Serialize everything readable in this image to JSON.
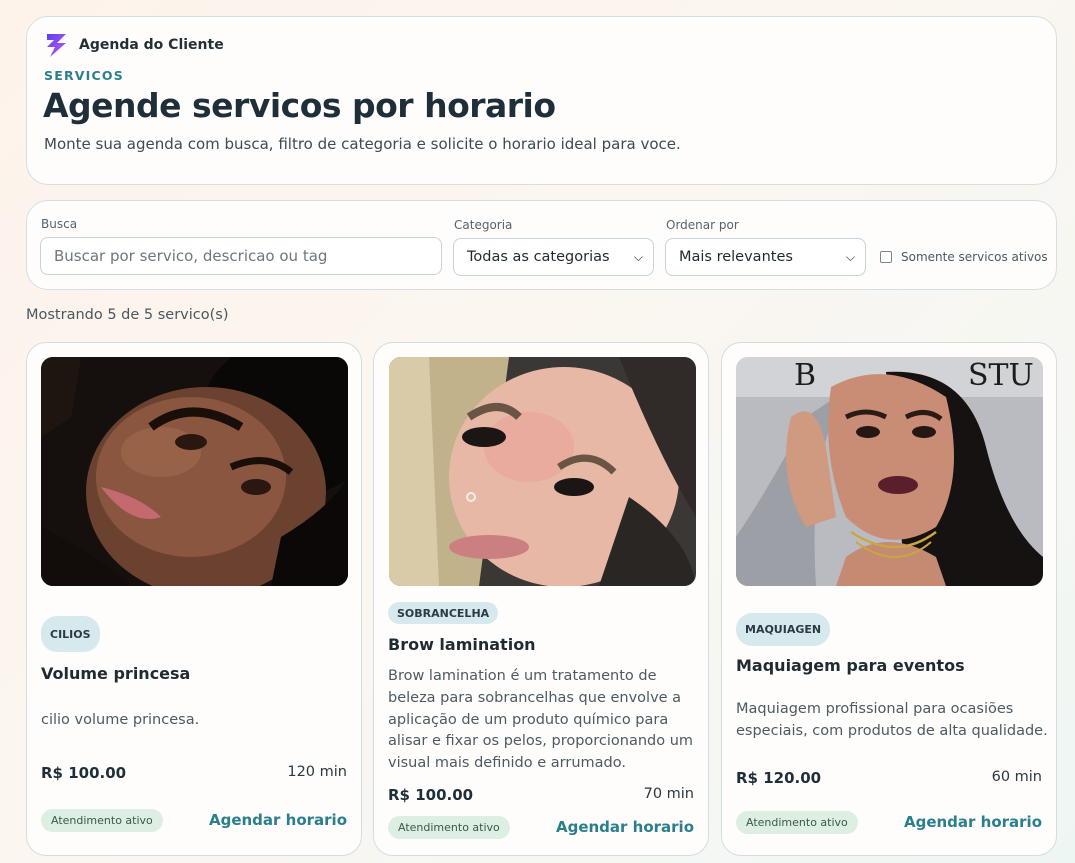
{
  "header": {
    "brand_name": "Agenda do Cliente",
    "brand_icon": "lightning-bolt-icon",
    "eyebrow": "SERVICOS",
    "title": "Agende servicos por horario",
    "subtitle": "Monte sua agenda com busca, filtro de categoria e solicite o horario ideal para voce."
  },
  "filters": {
    "search_label": "Busca",
    "search_placeholder": "Buscar por servico, descricao ou tag",
    "category_label": "Categoria",
    "category_value": "Todas as categorias",
    "sort_label": "Ordenar por",
    "sort_value": "Mais relevantes",
    "active_only_label": "Somente servicos ativos",
    "active_only_checked": false
  },
  "results_count": "Mostrando 5 de 5 servico(s)",
  "colors": {
    "accent": "#2a7f8d",
    "brand": "#7b3fe4",
    "status_bg": "#dcefe2"
  },
  "services": [
    {
      "category": "CILIOS",
      "name": "Volume princesa",
      "description": "cilio volume princesa.",
      "price": "R$ 100.00",
      "duration": "120 min",
      "status": "Atendimento ativo",
      "cta": "Agendar horario"
    },
    {
      "category": "SOBRANCELHA",
      "name": "Brow lamination",
      "description": "Brow lamination é um tratamento de beleza para sobrancelhas que envolve a aplicação de um produto químico para alisar e fixar os pelos, proporcionando um visual mais definido e arrumado.",
      "price": "R$ 100.00",
      "duration": "70 min",
      "status": "Atendimento ativo",
      "cta": "Agendar horario"
    },
    {
      "category": "MAQUIAGEN",
      "name": "Maquiagem para eventos",
      "description": "Maquiagem profissional para ocasiões especiais, com produtos de alta qualidade.",
      "price": "R$ 120.00",
      "duration": "60 min",
      "status": "Atendimento ativo",
      "cta": "Agendar horario"
    }
  ]
}
